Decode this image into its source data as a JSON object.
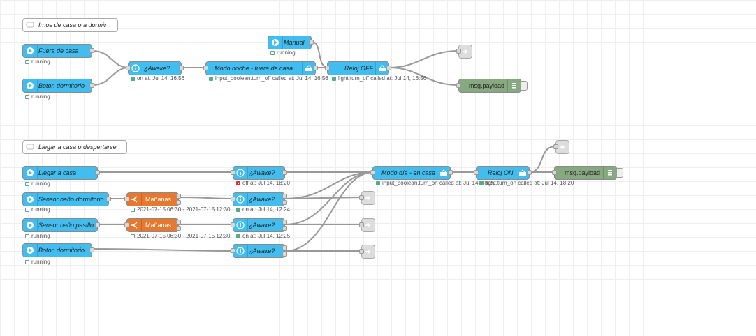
{
  "flow1": {
    "comment": "Irnos de casa o a dormir",
    "fuera_de_casa": {
      "label": "Fuera de casa",
      "status": "running"
    },
    "boton_dormitorio": {
      "label": "Boton dormitorio",
      "status": "running"
    },
    "awake": {
      "label": "¿Awake?",
      "status": "on at: Jul 14, 16:56"
    },
    "modo_noche": {
      "label": "Modo noche - fuera de casa",
      "status": "input_boolean.turn_off called at: Jul 14, 16:56"
    },
    "manual": {
      "label": "Manual",
      "status": "running"
    },
    "reloj_off": {
      "label": "Reloj OFF",
      "status": "light.turn_off called at: Jul 14, 16:56"
    },
    "debug": {
      "label": "msg.payload"
    }
  },
  "flow2": {
    "comment": "Llegar a casa o despertarse",
    "llegar_a_casa": {
      "label": "Llegar a casa",
      "status": "running"
    },
    "sensor_dormitorio": {
      "label": "Sensor baño dormitorio",
      "status": "running"
    },
    "sensor_pasillo": {
      "label": "Sensor baño pasillo",
      "status": "running"
    },
    "boton_dormitorio": {
      "label": "Boton dormitorio",
      "status": "running"
    },
    "mananas_1": {
      "label": "Mañanas",
      "status": "2021-07-15 06:30 - 2021-07-15 12:30"
    },
    "mananas_2": {
      "label": "Mañanas",
      "status": "2021-07-15 06:30 - 2021-07-15 12:30"
    },
    "awake_1": {
      "label": "¿Awake?",
      "status": "off at: Jul 14, 18:20"
    },
    "awake_2": {
      "label": "¿Awake?",
      "status": "on at: Jul 14, 12:24"
    },
    "awake_3": {
      "label": "¿Awake?",
      "status": "on at: Jul 14, 12:25"
    },
    "awake_4": {
      "label": "¿Awake?",
      "status": ""
    },
    "modo_dia": {
      "label": "Modo día - en casa",
      "status": "input_boolean.turn_on called at: Jul 14, 18:20"
    },
    "reloj_on": {
      "label": "Reloj ON",
      "status": "light.turn_on called at: Jul 14, 18:20"
    },
    "debug": {
      "label": "msg.payload"
    }
  },
  "colors": {
    "home_assistant": "#41bdf0",
    "switch": "#e9782f",
    "debug": "#87a980",
    "wire": "#999999"
  }
}
